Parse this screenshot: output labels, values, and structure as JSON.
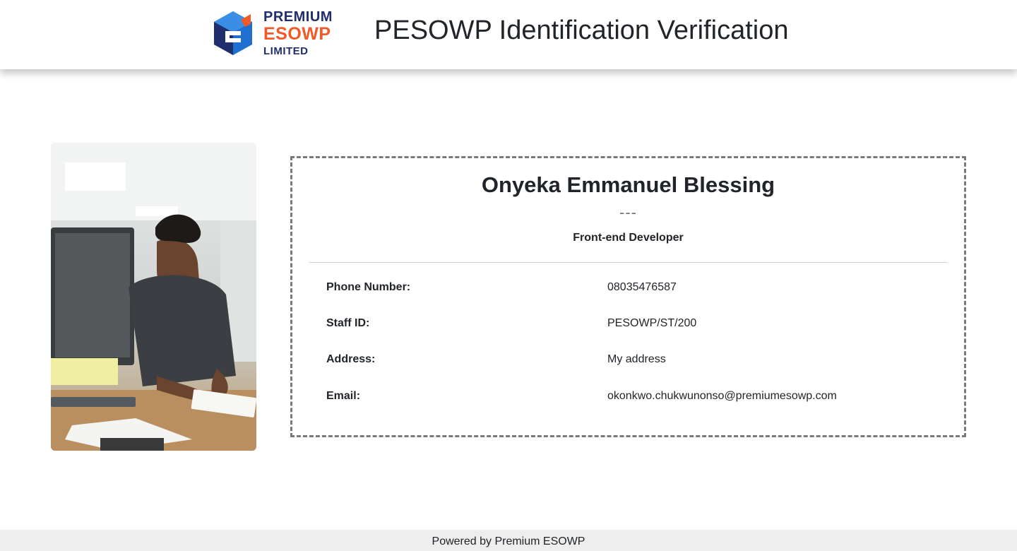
{
  "header": {
    "logo": {
      "line1": "PREMIUM",
      "line2": "ESOWP",
      "line3": "LIMITED",
      "colors": {
        "navy": "#1f2f6d",
        "orange": "#f05a28",
        "blue": "#1e6fd0"
      }
    },
    "title": "PESOWP Identification Verification"
  },
  "profile": {
    "name": "Onyeka Emmanuel Blessing",
    "separator": "---",
    "role": "Front-end Developer",
    "fields": [
      {
        "label": "Phone Number:",
        "value": "08035476587"
      },
      {
        "label": "Staff ID:",
        "value": "PESOWP/ST/200"
      },
      {
        "label": "Address:",
        "value": "My address"
      },
      {
        "label": "Email:",
        "value": "okonkwo.chukwunonso@premiumesowp.com"
      }
    ]
  },
  "footer": {
    "text": "Powered by Premium ESOWP"
  }
}
